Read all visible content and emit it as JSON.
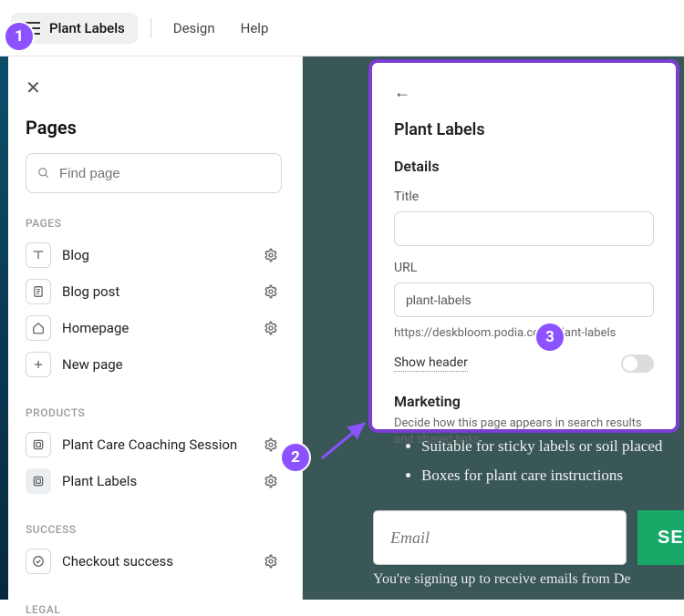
{
  "topbar": {
    "chip_label": "Plant Labels",
    "nav": {
      "design": "Design",
      "help": "Help"
    }
  },
  "sidebar": {
    "title": "Pages",
    "search_placeholder": "Find page",
    "sections": {
      "pages_label": "PAGES",
      "products_label": "PRODUCTS",
      "success_label": "SUCCESS",
      "legal_label": "LEGAL"
    },
    "pages": [
      {
        "label": "Blog"
      },
      {
        "label": "Blog post"
      },
      {
        "label": "Homepage"
      },
      {
        "label": "New page"
      }
    ],
    "products": [
      {
        "label": "Plant Care Coaching Session"
      },
      {
        "label": "Plant Labels"
      }
    ],
    "success": [
      {
        "label": "Checkout success"
      }
    ]
  },
  "preview": {
    "bullets": [
      "Suitable for sticky labels or soil placed",
      "Boxes for plant care instructions"
    ],
    "email_placeholder": "Email",
    "send_label": "SE",
    "signup_note": "You're signing up to receive emails from De"
  },
  "panel": {
    "title": "Plant Labels",
    "details_heading": "Details",
    "title_label": "Title",
    "title_value": "",
    "url_label": "URL",
    "url_value": "plant-labels",
    "full_url": "https://deskbloom.podia.com/plant-labels",
    "show_header_label": "Show header",
    "marketing_heading": "Marketing",
    "marketing_desc": "Decide how this page appears in search results and shared links."
  },
  "steps": {
    "s1": "1",
    "s2": "2",
    "s3": "3"
  }
}
